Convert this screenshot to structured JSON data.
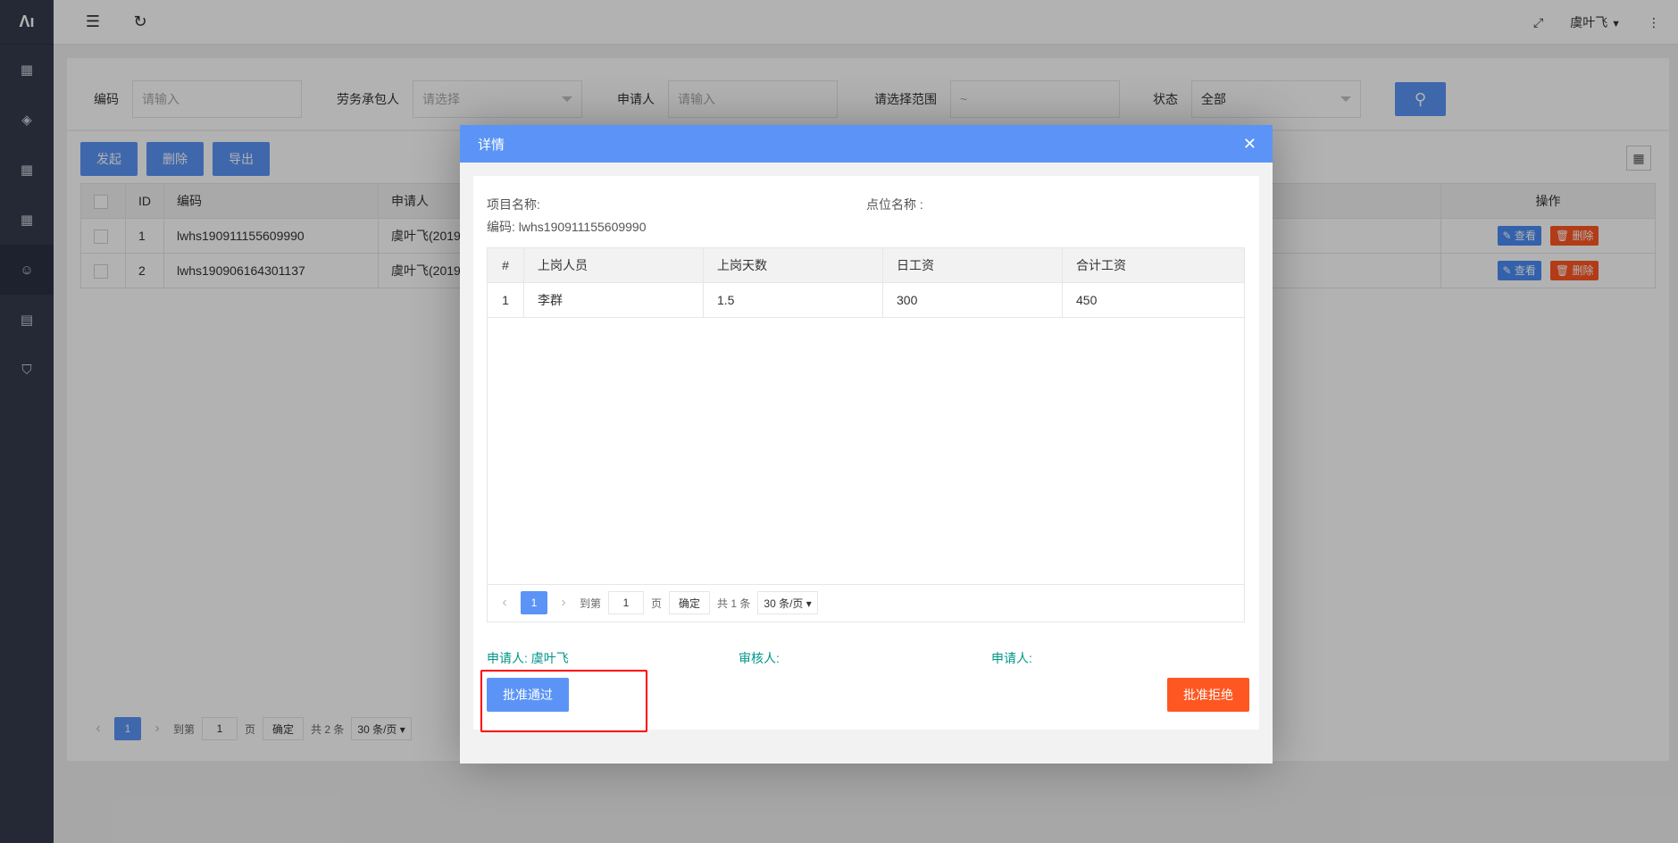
{
  "sidebar": {
    "logo": "Ʌı",
    "items": [
      {
        "icon": "grid-plus-icon",
        "glyph": "▦"
      },
      {
        "icon": "layers-icon",
        "glyph": "◈"
      },
      {
        "icon": "grid-plus-icon",
        "glyph": "▦"
      },
      {
        "icon": "grid-plus-icon",
        "glyph": "▦"
      },
      {
        "icon": "user-icon",
        "glyph": "☺",
        "active": true
      },
      {
        "icon": "document-icon",
        "glyph": "▤"
      },
      {
        "icon": "shield-check-icon",
        "glyph": "⛉"
      }
    ]
  },
  "header": {
    "menu_glyph": "☰",
    "refresh_glyph": "↻",
    "fullscreen_glyph": "⤢",
    "user_name": "虞叶飞",
    "user_caret": "▼",
    "more_glyph": "⋮"
  },
  "search": {
    "code_label": "编码",
    "code_placeholder": "请输入",
    "contractor_label": "劳务承包人",
    "contractor_placeholder": "请选择",
    "applicant_label": "申请人",
    "applicant_placeholder": "请输入",
    "range_label": "请选择范围",
    "range_value": "~",
    "status_label": "状态",
    "status_value": "全部",
    "search_glyph": "⚲"
  },
  "toolbar": {
    "launch": "发起",
    "delete": "删除",
    "export": "导出",
    "grid_glyph": "▦"
  },
  "main_table": {
    "headers": [
      "ID",
      "编码",
      "申请人",
      "操作"
    ],
    "rows": [
      {
        "id": "1",
        "code": "lwhs190911155609990",
        "applicant": "虞叶飞(2019-",
        "view": "✎ 查看",
        "del": "🗑 删除"
      },
      {
        "id": "2",
        "code": "lwhs190906164301137",
        "applicant": "虞叶飞(2019-",
        "view": "✎ 查看",
        "del": "🗑 删除"
      }
    ]
  },
  "main_pager": {
    "prev": "‹",
    "current": "1",
    "next": "›",
    "goto_label": "到第",
    "goto_value": "1",
    "page_label": "页",
    "confirm": "确定",
    "total": "共 2 条",
    "page_size": "30 条/页 ▾"
  },
  "modal": {
    "title": "详情",
    "close_glyph": "✕",
    "project_label": "项目名称:",
    "point_label": "点位名称 :",
    "code_line": "编码: lwhs190911155609990",
    "headers": [
      "#",
      "上岗人员",
      "上岗天数",
      "日工资",
      "合计工资"
    ],
    "rows": [
      {
        "no": "1",
        "name": "李群",
        "days": "1.5",
        "daily": "300",
        "total": "450"
      }
    ],
    "pager": {
      "prev": "‹",
      "current": "1",
      "next": "›",
      "goto_label": "到第",
      "goto_value": "1",
      "page_label": "页",
      "confirm": "确定",
      "total": "共 1 条",
      "page_size": "30 条/页 ▾"
    },
    "sign_applicant": "申请人: 虞叶飞",
    "sign_reviewer": "审核人:",
    "sign_applicant2": "申请人:",
    "approve": "批准通过",
    "reject": "批准拒绝"
  },
  "colors": {
    "primary": "#5b94f6",
    "danger": "#ff5722",
    "sidebar": "#343b4d",
    "sign_text": "#009688",
    "highlight": "#ff0000"
  }
}
